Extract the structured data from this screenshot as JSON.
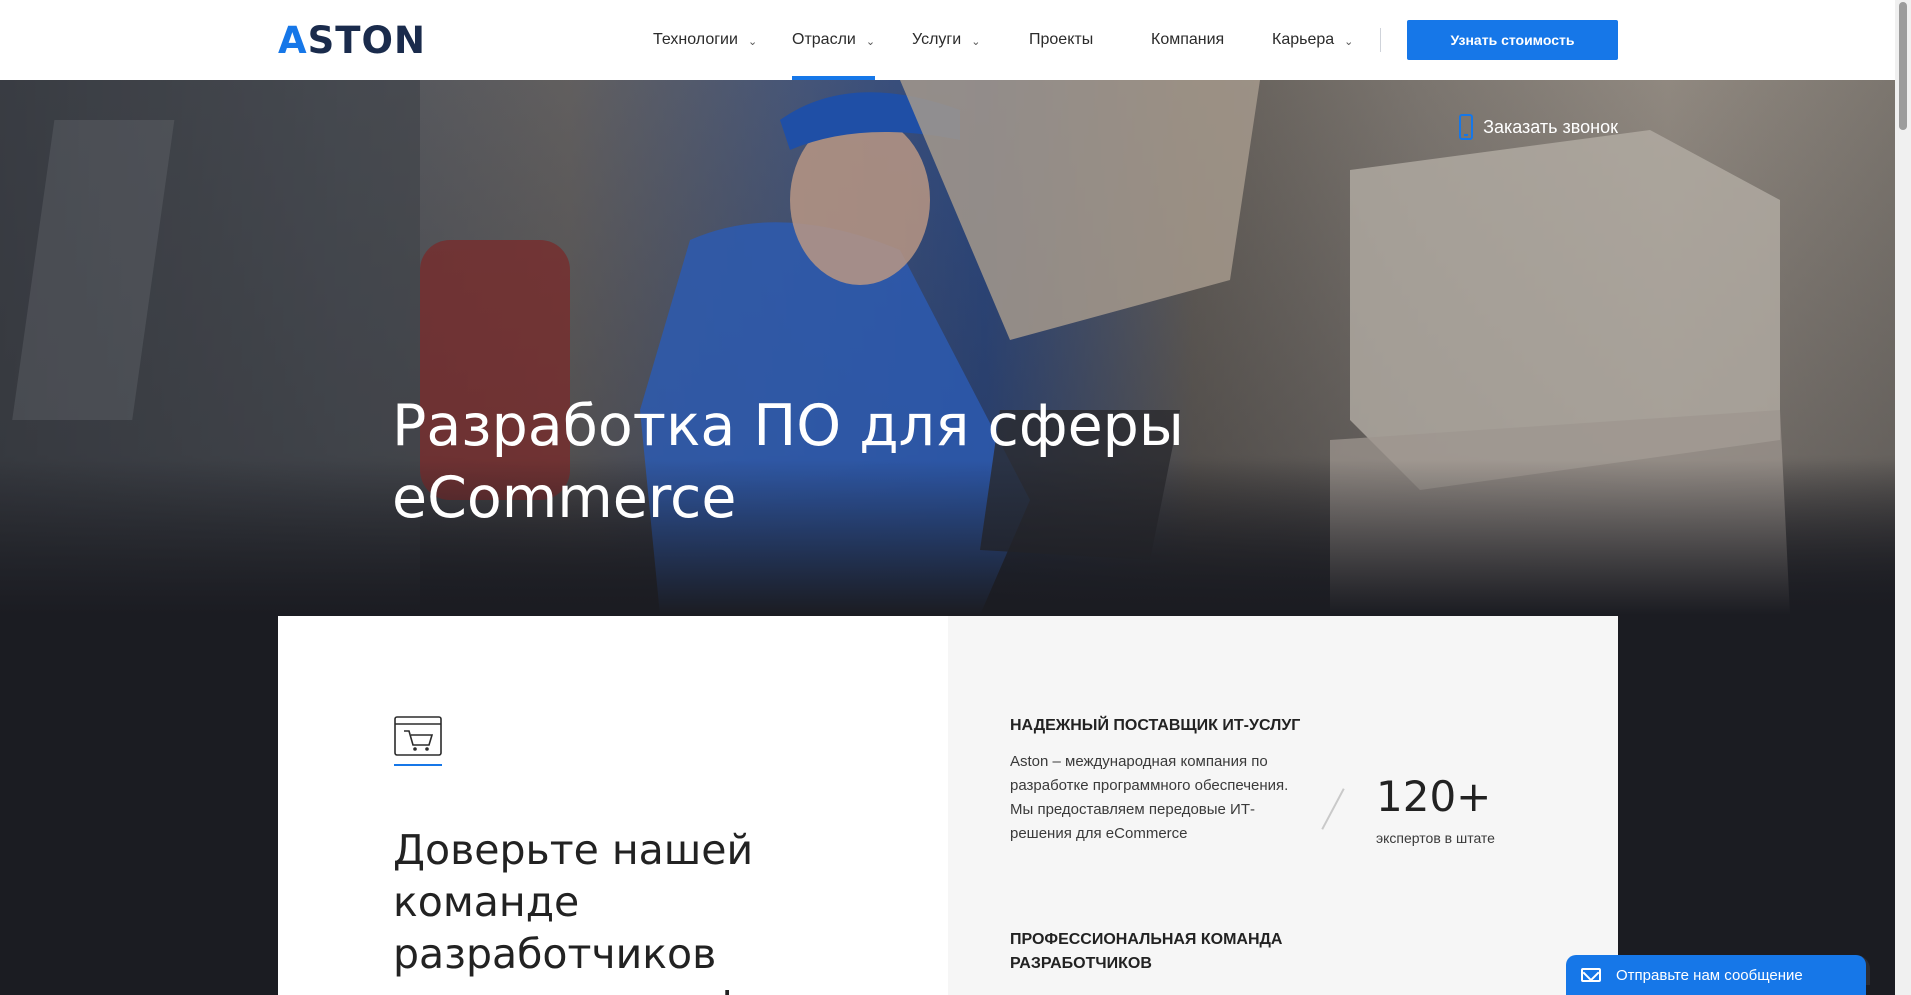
{
  "header": {
    "logo_text": "ASTON",
    "nav": [
      {
        "label": "Технологии",
        "has_dropdown": true
      },
      {
        "label": "Отрасли",
        "has_dropdown": true,
        "active": true
      },
      {
        "label": "Услуги",
        "has_dropdown": true
      },
      {
        "label": "Проекты",
        "has_dropdown": false
      },
      {
        "label": "Компания",
        "has_dropdown": false
      },
      {
        "label": "Карьера",
        "has_dropdown": true
      }
    ],
    "cta_label": "Узнать стоимость",
    "chevron_icon": "chevron-down-icon"
  },
  "hero": {
    "call_label": "Заказать звонок",
    "call_icon": "phone-icon",
    "title": "Разработка ПО для сферы eCommerce"
  },
  "content": {
    "icon": "shopping-cart-icon",
    "lead": "Доверьте нашей команде разработчиков создание платформы,",
    "features": [
      {
        "title": "НАДЕЖНЫЙ ПОСТАВЩИК ИТ-УСЛУГ",
        "text": "Aston – международная компания по разработке программного обеспечения. Мы предоставляем передовые ИТ-решения для eCommerce"
      },
      {
        "title": "ПРОФЕССИОНАЛЬНАЯ КОМАНДА РАЗРАБОТЧИКОВ"
      }
    ],
    "stat": {
      "value": "120+",
      "label": "экспертов в штате"
    }
  },
  "chat": {
    "label": "Отправьте нам сообщение",
    "icon": "envelope-icon"
  },
  "colors": {
    "accent": "#1677e8",
    "logo_dark": "#1a2b4c",
    "dark_bg": "#1b1c22",
    "card_right_bg": "#f6f6f6"
  }
}
